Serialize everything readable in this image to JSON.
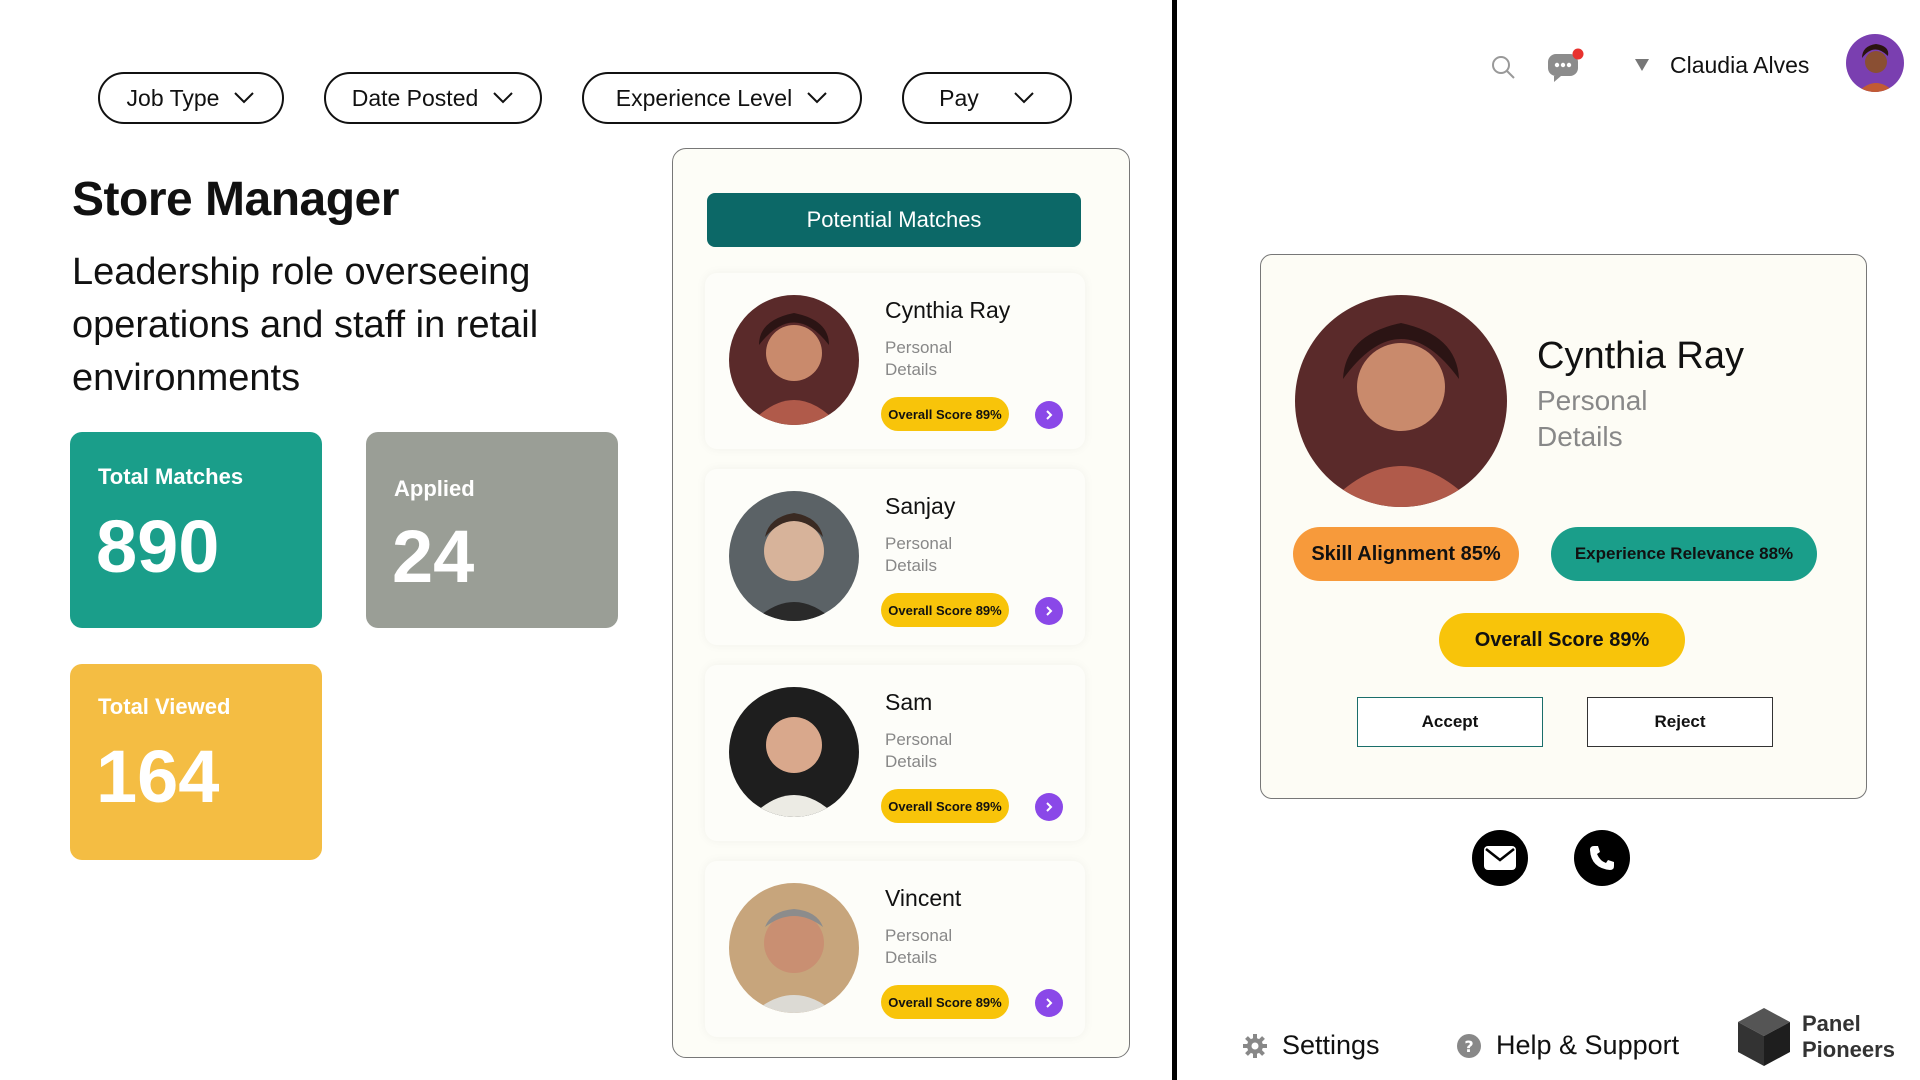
{
  "filters": [
    {
      "label": "Job Type"
    },
    {
      "label": "Date Posted"
    },
    {
      "label": "Experience Level"
    },
    {
      "label": "Pay"
    }
  ],
  "job": {
    "title": "Store Manager",
    "description": "Leadership role overseeing operations and staff in retail environments"
  },
  "stats": {
    "total_matches": {
      "label": "Total Matches",
      "value": "890",
      "color": "#1a9e8a"
    },
    "applied": {
      "label": "Applied",
      "value": "24",
      "color": "#9a9e96"
    },
    "total_viewed": {
      "label": "Total Viewed",
      "value": "164",
      "color": "#f4bd43"
    }
  },
  "matches_panel": {
    "header": "Potential Matches",
    "items": [
      {
        "name": "Cynthia Ray",
        "details": "Personal Details",
        "score": "Overall Score 89%"
      },
      {
        "name": "Sanjay",
        "details": "Personal Details",
        "score": "Overall Score 89%"
      },
      {
        "name": "Sam",
        "details": "Personal Details",
        "score": "Overall Score 89%"
      },
      {
        "name": "Vincent",
        "details": "Personal Details",
        "score": "Overall Score 89%"
      }
    ]
  },
  "header": {
    "user_name": "Claudia Alves",
    "icons": [
      "search-icon",
      "chat-icon",
      "dropdown-arrow-icon",
      "user-avatar"
    ]
  },
  "profile": {
    "name": "Cynthia Ray",
    "details": "Personal Details",
    "skill_alignment": "Skill Alignment 85%",
    "experience_relevance": "Experience Relevance 88%",
    "overall_score": "Overall Score 89%",
    "accept_label": "Accept",
    "reject_label": "Reject",
    "colors": {
      "skill": "#f79a3b",
      "experience": "#1a9e8a",
      "overall": "#f8c40a"
    }
  },
  "footer": {
    "settings_label": "Settings",
    "help_label": "Help & Support",
    "brand_line1": "Panel",
    "brand_line2": "Pioneers"
  }
}
